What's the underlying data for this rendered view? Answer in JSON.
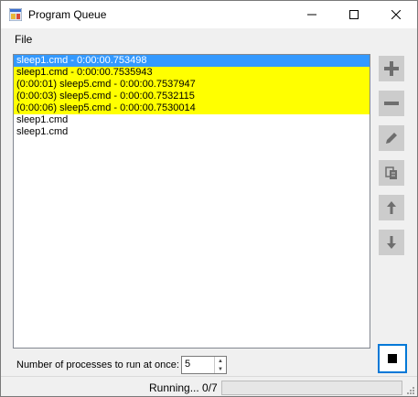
{
  "window": {
    "title": "Program Queue"
  },
  "menu": {
    "file": "File"
  },
  "queue": [
    {
      "text": "sleep1.cmd - 0:00:00.753498",
      "state": "selected"
    },
    {
      "text": "sleep1.cmd - 0:00:00.7535943",
      "state": "running"
    },
    {
      "text": "(0:00:01) sleep5.cmd - 0:00:00.7537947",
      "state": "running"
    },
    {
      "text": "(0:00:03) sleep5.cmd - 0:00:00.7532115",
      "state": "running"
    },
    {
      "text": "(0:00:06) sleep5.cmd - 0:00:00.7530014",
      "state": "running"
    },
    {
      "text": "sleep1.cmd",
      "state": "pending"
    },
    {
      "text": "sleep1.cmd",
      "state": "pending"
    }
  ],
  "side_buttons": [
    {
      "name": "add",
      "icon": "plus-icon"
    },
    {
      "name": "remove",
      "icon": "minus-icon"
    },
    {
      "name": "edit",
      "icon": "pencil-icon"
    },
    {
      "name": "copy",
      "icon": "copy-icon"
    },
    {
      "name": "move-up",
      "icon": "arrow-up-icon"
    },
    {
      "name": "move-down",
      "icon": "arrow-down-icon"
    }
  ],
  "processes": {
    "label": "Number of processes to run at once:",
    "value": "5"
  },
  "status": {
    "text": "Running... 0/7",
    "progress": 0
  },
  "colors": {
    "selected": "#3399ff",
    "running": "#ffff00",
    "button": "#cccccc",
    "focus": "#0078d7"
  }
}
